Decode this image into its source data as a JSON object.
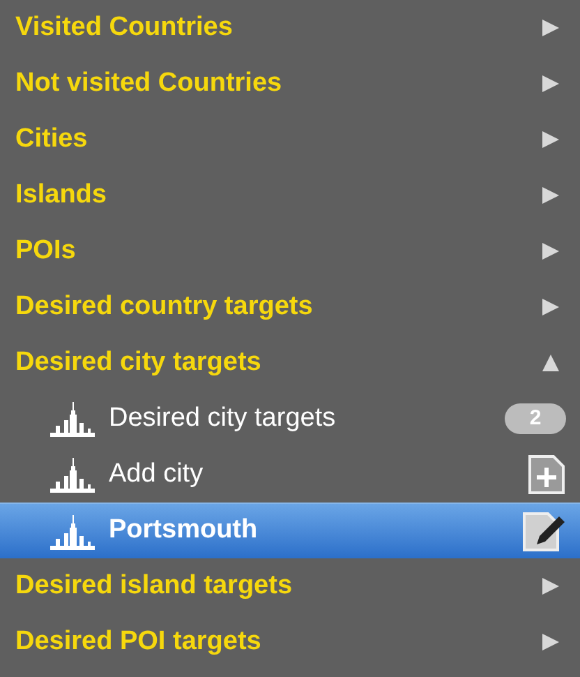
{
  "groups": [
    {
      "label": "Visited Countries",
      "expanded": false
    },
    {
      "label": "Not visited Countries",
      "expanded": false
    },
    {
      "label": "Cities",
      "expanded": false
    },
    {
      "label": "Islands",
      "expanded": false
    },
    {
      "label": "POIs",
      "expanded": false
    },
    {
      "label": "Desired country targets",
      "expanded": false
    },
    {
      "label": "Desired city targets",
      "expanded": true,
      "children": [
        {
          "label": "Desired city targets",
          "kind": "count",
          "count": "2",
          "selected": false
        },
        {
          "label": "Add city",
          "kind": "add",
          "selected": false
        },
        {
          "label": "Portsmouth",
          "kind": "edit",
          "selected": true
        }
      ]
    },
    {
      "label": "Desired island targets",
      "expanded": false
    },
    {
      "label": "Desired POI targets",
      "expanded": false
    }
  ]
}
